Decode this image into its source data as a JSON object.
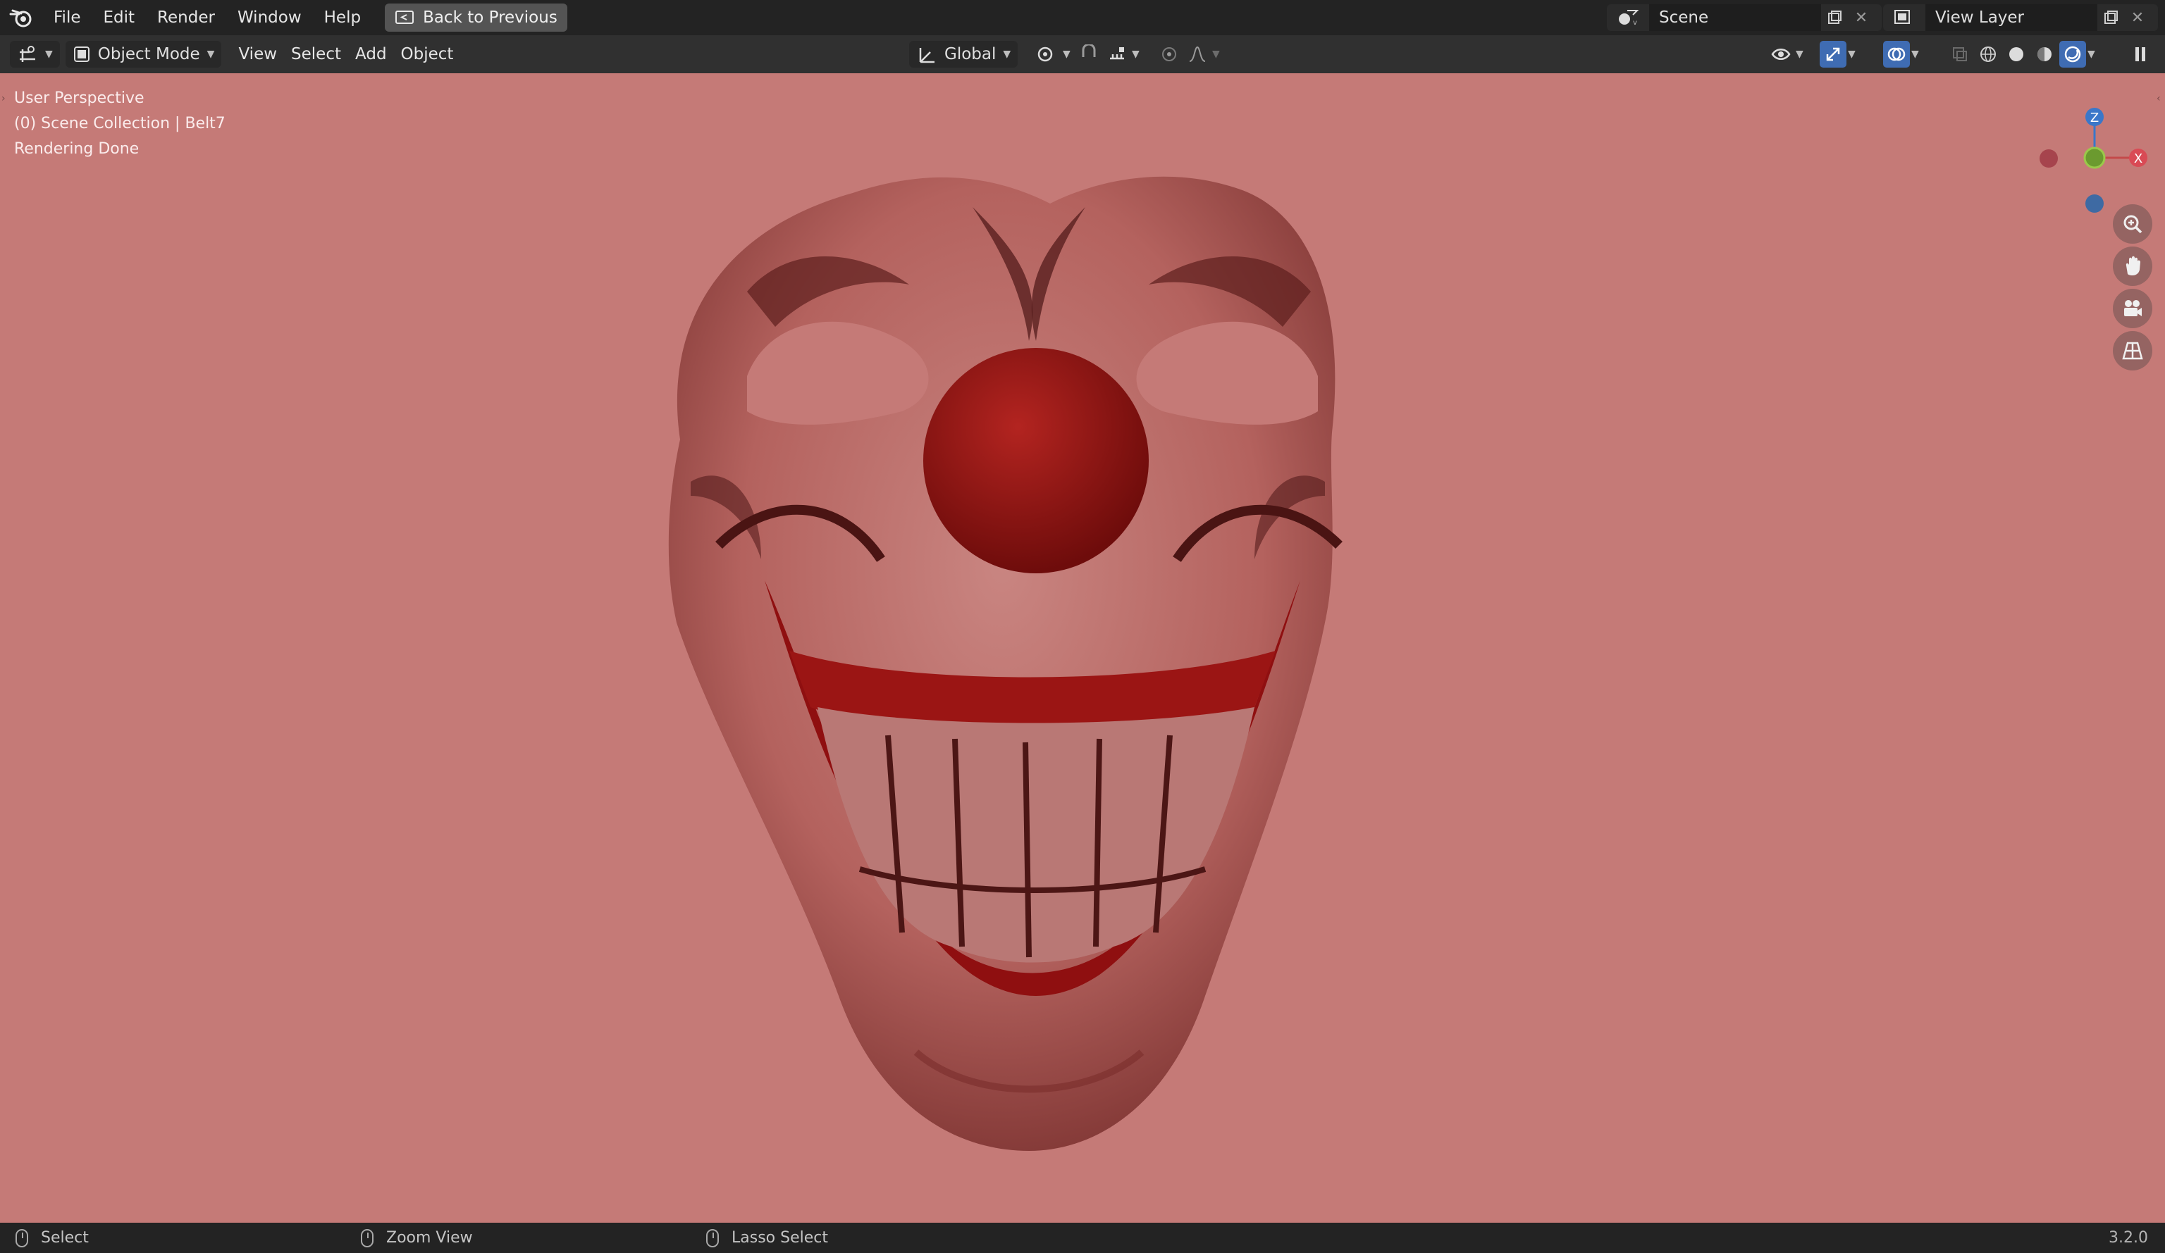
{
  "topbar": {
    "menus": [
      "File",
      "Edit",
      "Render",
      "Window",
      "Help"
    ],
    "back_label": "Back to Previous",
    "scene_label": "Scene",
    "view_layer_label": "View Layer"
  },
  "toolbar": {
    "mode_label": "Object Mode",
    "menus": [
      "View",
      "Select",
      "Add",
      "Object"
    ],
    "orientation_label": "Global"
  },
  "viewport": {
    "line1": "User Perspective",
    "line2": "(0) Scene Collection | Belt7",
    "line3": "Rendering Done",
    "gizmo": {
      "z": "Z",
      "x": "X"
    },
    "background_color": "#c57a77"
  },
  "statusbar": {
    "select_label": "Select",
    "zoom_label": "Zoom View",
    "lasso_label": "Lasso Select",
    "version": "3.2.0"
  },
  "icons": [
    "blender-logo-icon",
    "editor-type-icon",
    "object-mode-icon",
    "transform-orientation-icon",
    "pivot-icon",
    "snap-icon",
    "proportional-edit-icon",
    "visibility-icon",
    "gizmo-icon",
    "overlay-icon",
    "xray-icon",
    "wireframe-shading-icon",
    "solid-shading-icon",
    "material-shading-icon",
    "rendered-shading-icon",
    "zoom-icon",
    "hand-icon",
    "camera-icon",
    "grid-icon"
  ]
}
